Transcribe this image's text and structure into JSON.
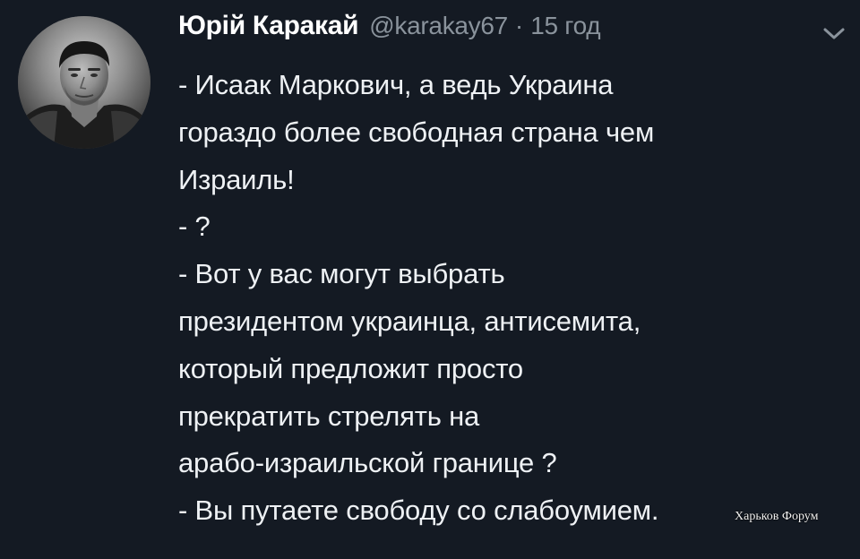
{
  "tweet": {
    "author_name": "Юрій Каракай",
    "author_handle": "@karakay67",
    "separator": "·",
    "time": "15 год",
    "lines": [
      "- Исаак Маркович, а ведь Украина",
      "гораздо более свободная страна чем",
      "Израиль!",
      "- ?",
      "- Вот у вас могут выбрать",
      "президентом украинца,  антисемита,",
      "который предложит просто",
      "прекратить стрелять на",
      "арабо-израильской границе ?",
      "- Вы путаете свободу со слабоумием."
    ]
  },
  "watermark": "Харьков Форум",
  "icons": {
    "menu": "chevron-down-icon"
  },
  "colors": {
    "background": "#141a23",
    "text": "#eef1f4",
    "muted": "#8a939c"
  }
}
